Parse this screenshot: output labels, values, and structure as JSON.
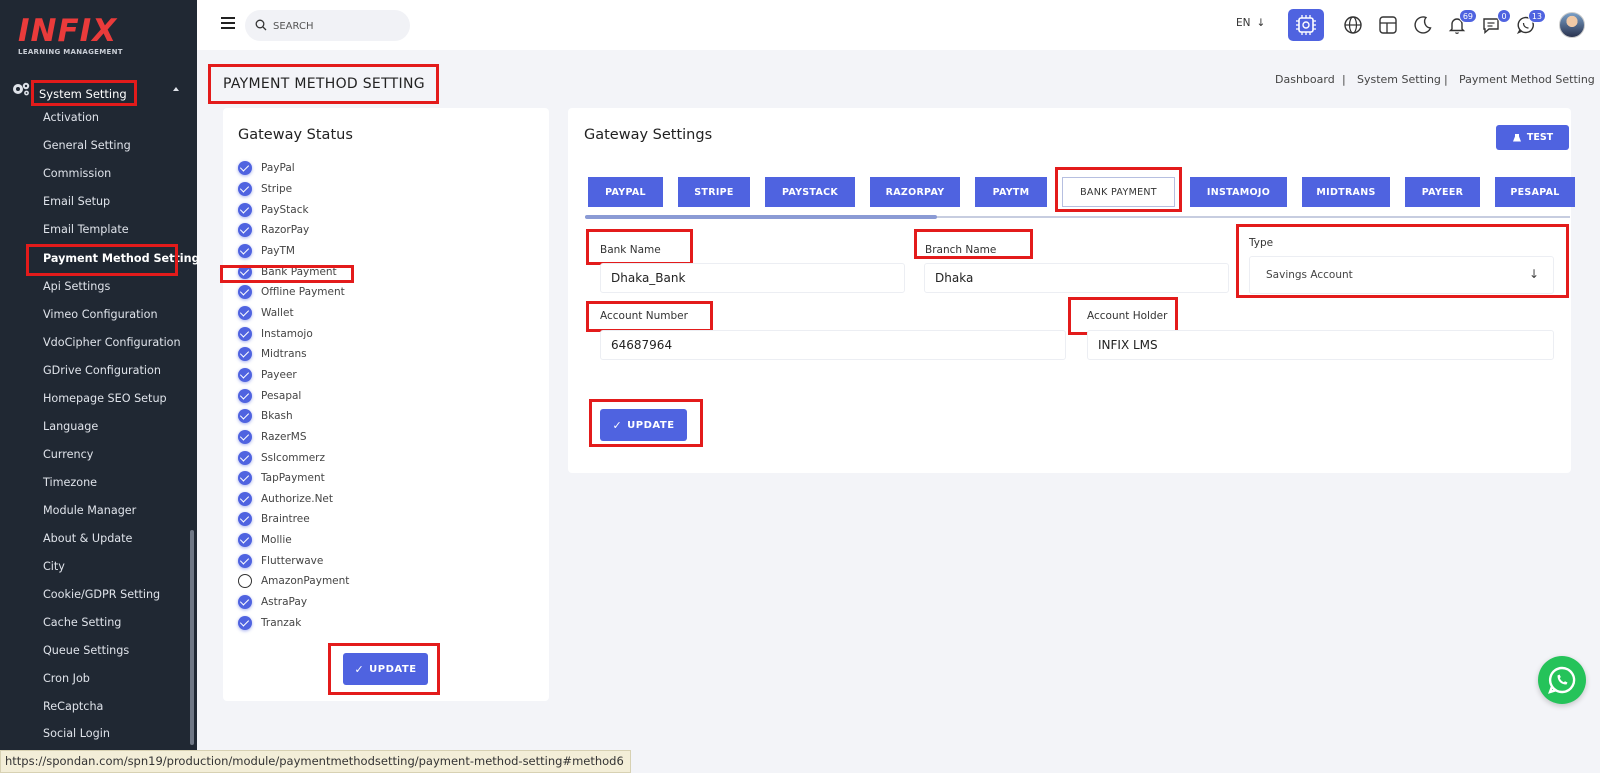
{
  "sidebar": {
    "logo_main": "INFIX",
    "logo_sub": "LEARNING MANAGEMENT",
    "section_label": "System Setting",
    "items": [
      {
        "label": "Activation"
      },
      {
        "label": "General Setting"
      },
      {
        "label": "Commission"
      },
      {
        "label": "Email Setup"
      },
      {
        "label": "Email Template"
      },
      {
        "label": "Payment Method Setting",
        "active": true
      },
      {
        "label": "Api Settings"
      },
      {
        "label": "Vimeo Configuration"
      },
      {
        "label": "VdoCipher Configuration"
      },
      {
        "label": "GDrive Configuration"
      },
      {
        "label": "Homepage SEO Setup"
      },
      {
        "label": "Language"
      },
      {
        "label": "Currency"
      },
      {
        "label": "Timezone"
      },
      {
        "label": "Module Manager"
      },
      {
        "label": "About & Update"
      },
      {
        "label": "City"
      },
      {
        "label": "Cookie/GDPR Setting"
      },
      {
        "label": "Cache Setting"
      },
      {
        "label": "Queue Settings"
      },
      {
        "label": "Cron Job"
      },
      {
        "label": "ReCaptcha"
      },
      {
        "label": "Social Login"
      }
    ]
  },
  "header": {
    "search_placeholder": "SEARCH",
    "language": "EN",
    "language_arrow": "↓",
    "notification_count": "69",
    "message_count": "0",
    "chat_count": "13"
  },
  "page": {
    "title": "PAYMENT METHOD SETTING",
    "breadcrumb": [
      "Dashboard",
      "|",
      "System Setting",
      "|",
      "Payment Method Setting"
    ]
  },
  "gateway_status": {
    "title": "Gateway Status",
    "items": [
      {
        "label": "PayPal",
        "checked": true
      },
      {
        "label": "Stripe",
        "checked": true
      },
      {
        "label": "PayStack",
        "checked": true
      },
      {
        "label": "RazorPay",
        "checked": true
      },
      {
        "label": "PayTM",
        "checked": true
      },
      {
        "label": "Bank Payment",
        "checked": true
      },
      {
        "label": "Offline Payment",
        "checked": true
      },
      {
        "label": "Wallet",
        "checked": true
      },
      {
        "label": "Instamojo",
        "checked": true
      },
      {
        "label": "Midtrans",
        "checked": true
      },
      {
        "label": "Payeer",
        "checked": true
      },
      {
        "label": "Pesapal",
        "checked": true
      },
      {
        "label": "Bkash",
        "checked": true
      },
      {
        "label": "RazerMS",
        "checked": true
      },
      {
        "label": "Sslcommerz",
        "checked": true
      },
      {
        "label": "TapPayment",
        "checked": true
      },
      {
        "label": "Authorize.Net",
        "checked": true
      },
      {
        "label": "Braintree",
        "checked": true
      },
      {
        "label": "Mollie",
        "checked": true
      },
      {
        "label": "Flutterwave",
        "checked": true
      },
      {
        "label": "AmazonPayment",
        "checked": false
      },
      {
        "label": "AstraPay",
        "checked": true
      },
      {
        "label": "Tranzak",
        "checked": true
      }
    ],
    "update_label": "UPDATE",
    "update_icon": "✓"
  },
  "gateway_settings": {
    "title": "Gateway Settings",
    "test_label": "TEST",
    "tabs": [
      {
        "label": "PAYPAL"
      },
      {
        "label": "STRIPE"
      },
      {
        "label": "PAYSTACK"
      },
      {
        "label": "RAZORPAY"
      },
      {
        "label": "PAYTM"
      },
      {
        "label": "BANK PAYMENT",
        "active": true
      },
      {
        "label": "INSTAMOJO"
      },
      {
        "label": "MIDTRANS"
      },
      {
        "label": "PAYEER"
      },
      {
        "label": "PESAPAL"
      }
    ],
    "fields": {
      "bank_name_label": "Bank Name",
      "bank_name_value": "Dhaka_Bank",
      "branch_name_label": "Branch Name",
      "branch_name_value": "Dhaka",
      "type_label": "Type",
      "type_value": "Savings Account",
      "account_number_label": "Account Number",
      "account_number_value": "64687964",
      "account_holder_label": "Account Holder",
      "account_holder_value": "INFIX LMS"
    },
    "update_label": "UPDATE",
    "update_icon": "✓"
  },
  "status_bar": {
    "url": "https://spondan.com/spn19/production/module/paymentmethodsetting/payment-method-setting#method6"
  },
  "colors": {
    "accent": "#4f63e0",
    "sidebar_bg": "#202833",
    "highlight": "#e31b1b",
    "whatsapp": "#25c35a"
  }
}
